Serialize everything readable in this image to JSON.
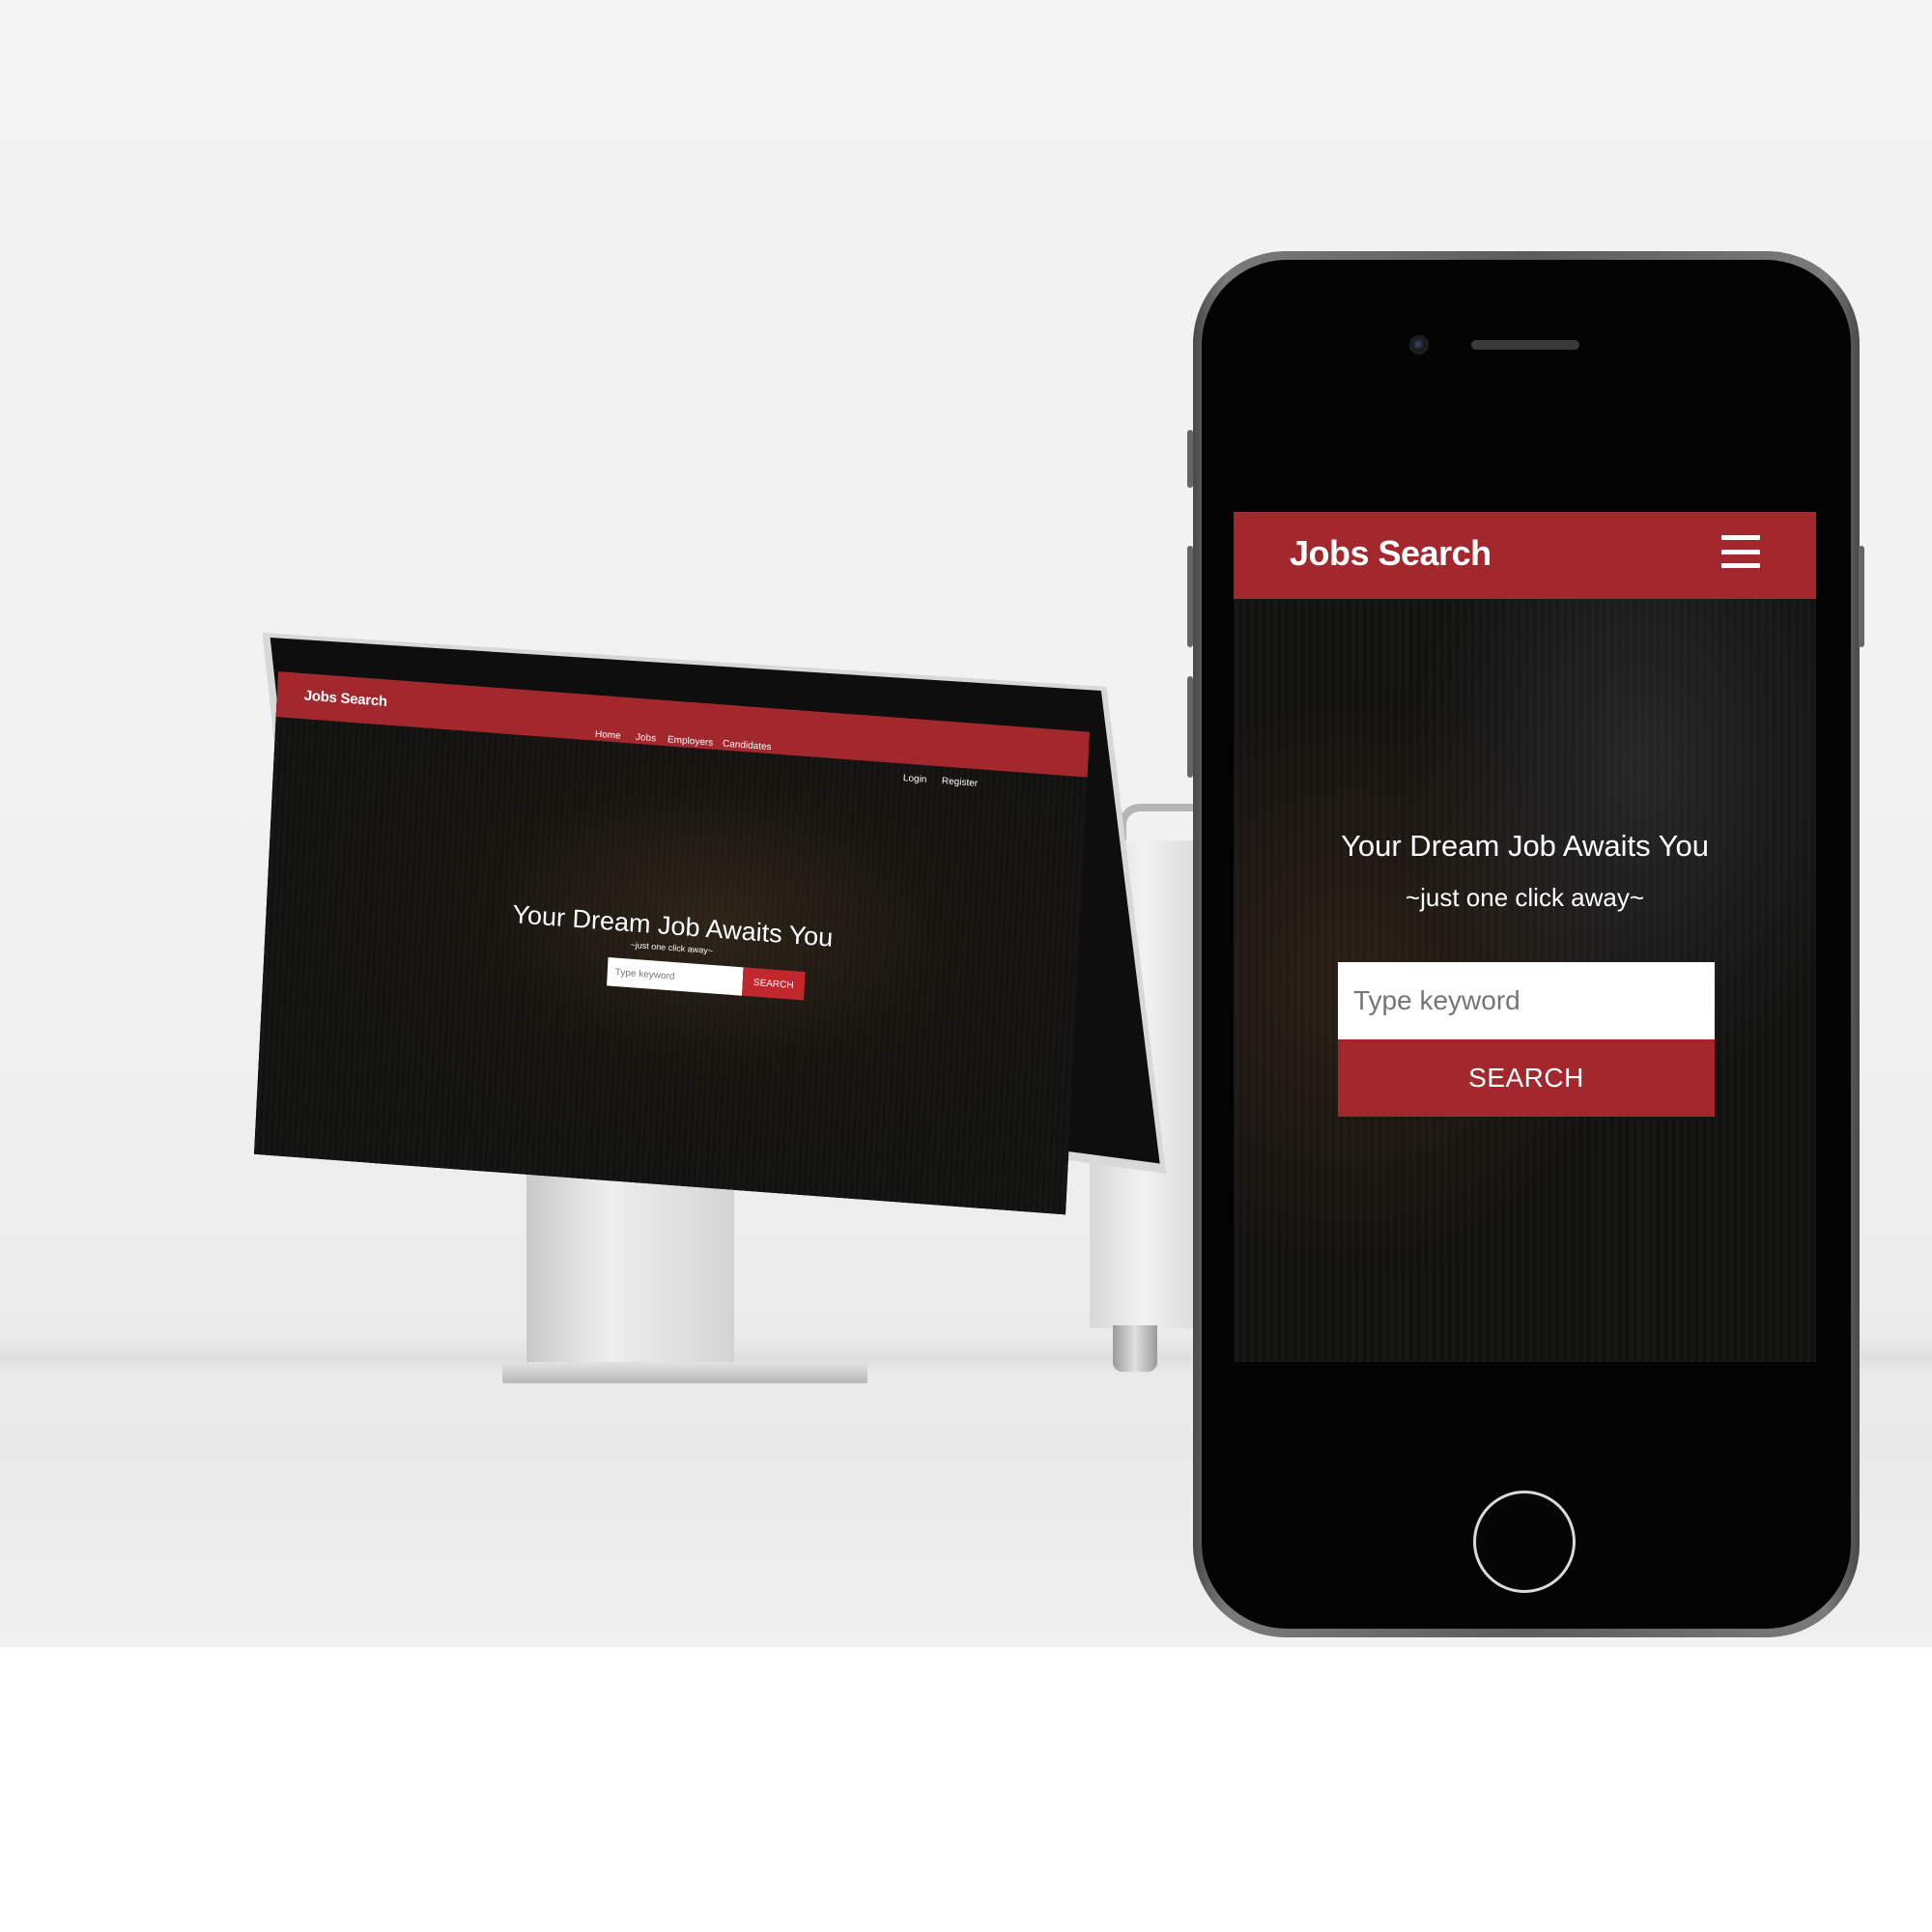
{
  "brand": "Jobs Search",
  "accent_color": "#a3282d",
  "nav": {
    "links": [
      "Home",
      "Jobs",
      "Employers",
      "Candidates"
    ],
    "auth": [
      "Login",
      "Register"
    ]
  },
  "hero": {
    "headline": "Your Dream Job Awaits You",
    "tagline": "~just one click away~",
    "search_placeholder": "Type keyword",
    "search_button": "SEARCH"
  },
  "icons": {
    "menu": "hamburger-menu-icon",
    "camera": "front-camera-icon",
    "home_button": "home-button-icon"
  }
}
